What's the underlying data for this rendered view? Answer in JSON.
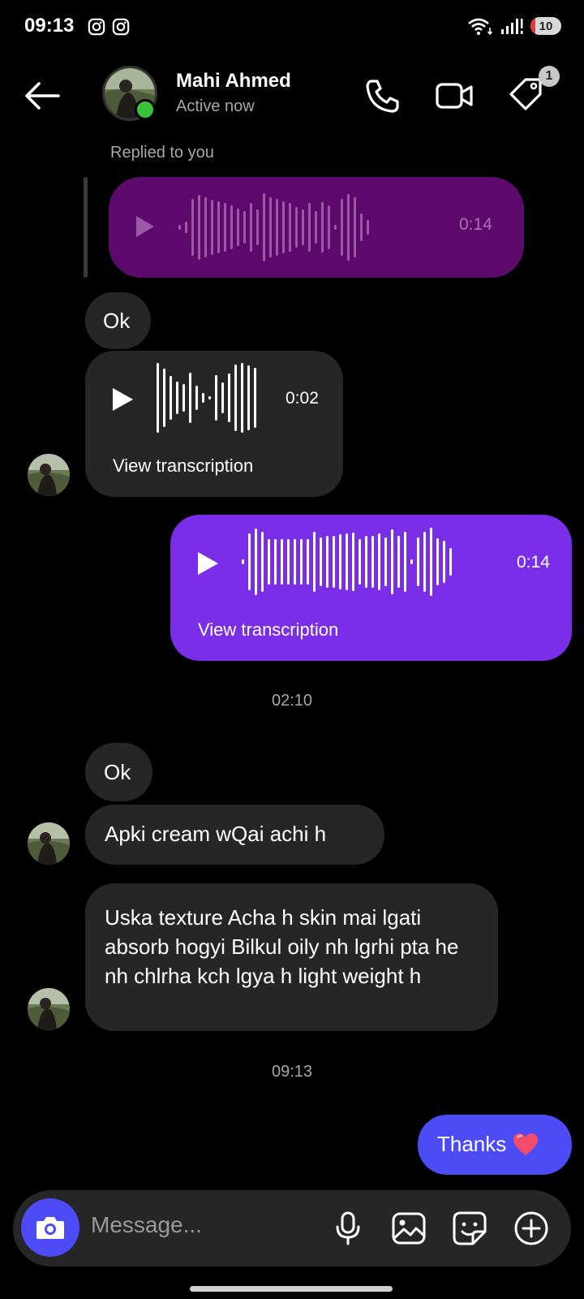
{
  "status_bar": {
    "time": "09:13",
    "battery": "10",
    "icons": [
      "instagram-icon",
      "instagram-icon",
      "wifi-icon",
      "signal-icon",
      "battery-icon"
    ]
  },
  "header": {
    "name": "Mahi Ahmed",
    "status": "Active now",
    "badge_count": "1",
    "icons": [
      "back-arrow-icon",
      "phone-icon",
      "video-icon",
      "tag-icon"
    ]
  },
  "messages": {
    "replied_label": "Replied to you",
    "reply_voice": {
      "duration": "0:14"
    },
    "ok_1": "Ok",
    "voice_in": {
      "duration": "0:02",
      "transcription": "View transcription"
    },
    "voice_out": {
      "duration": "0:14",
      "transcription": "View transcription"
    },
    "time_1": "02:10",
    "ok_2": "Ok",
    "cream_msg": "Apki cream wQai achi h",
    "long_msg": "Uska texture Acha h skin mai lgati absorb hogyi Bilkul oily nh lgrhi pta he nh chlrha kch lgya h light weight h",
    "time_2": "09:13",
    "thanks": "Thanks",
    "thanks_emoji": "heart-emoji"
  },
  "composer": {
    "placeholder": "Message...",
    "icons": [
      "camera-icon",
      "microphone-icon",
      "gallery-icon",
      "sticker-icon",
      "plus-icon"
    ]
  },
  "colors": {
    "background": "#000000",
    "incoming_bubble": "#262626",
    "outgoing_voice": "#7b2ee8",
    "outgoing_text": "#4d4bf6",
    "reply_preview": "#5c0b6d",
    "online": "#3ac13a"
  }
}
